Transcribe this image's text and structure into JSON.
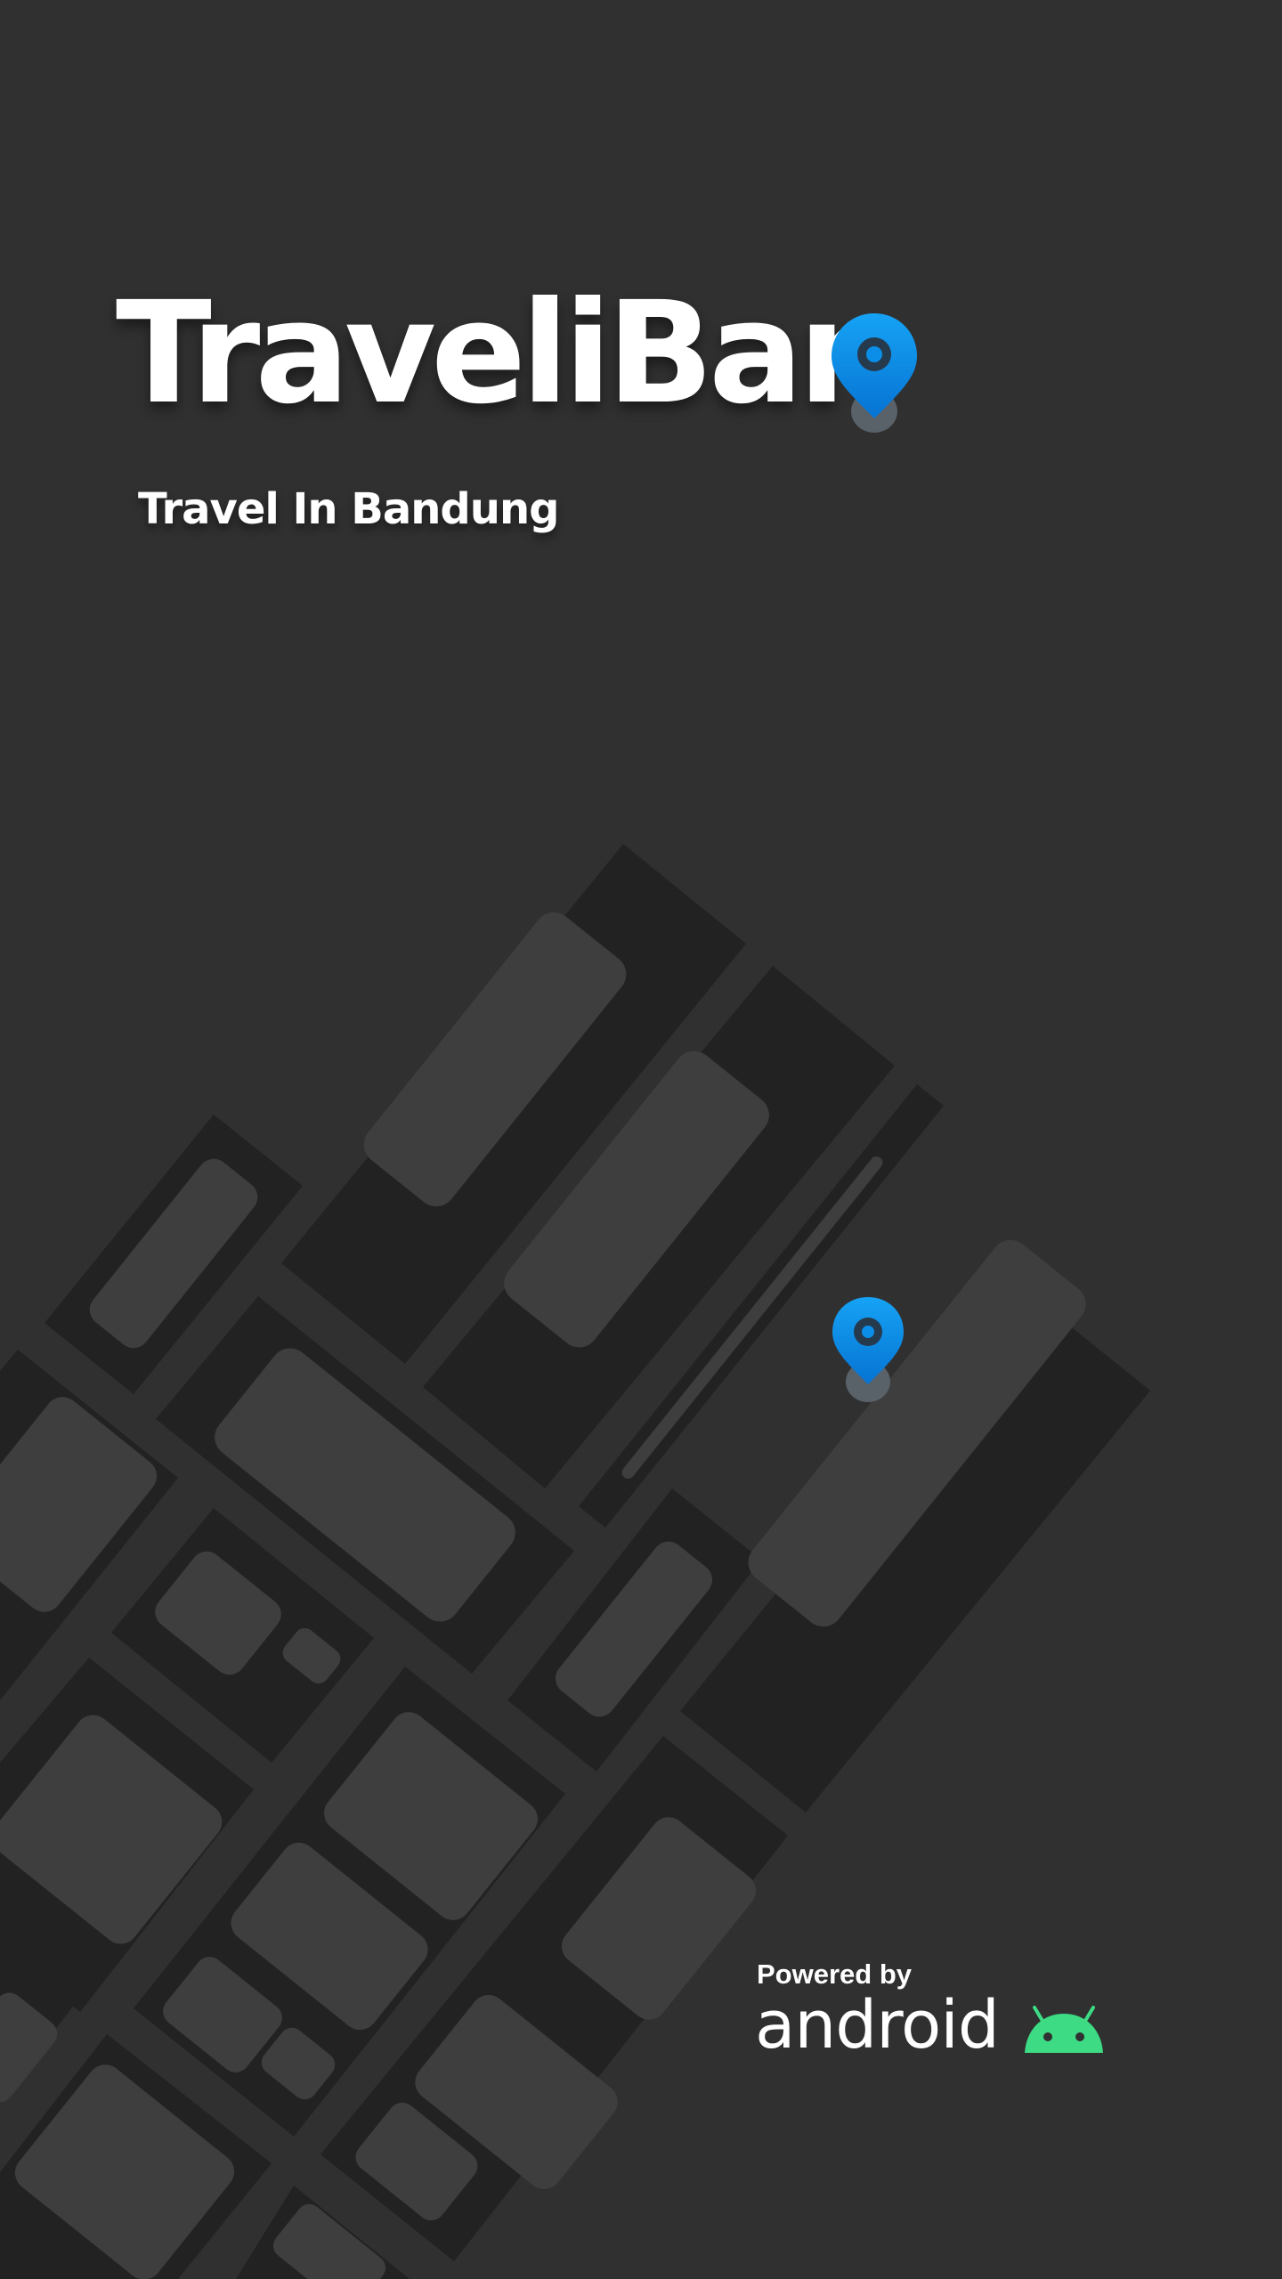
{
  "app": {
    "title": "TraveliBan",
    "subtitle": "Travel In Bandung"
  },
  "footer": {
    "powered_by": "Powered by",
    "platform": "android"
  },
  "icons": {
    "title_pin": "location-pin-icon",
    "map_pin": "location-pin-icon",
    "platform_logo": "android-robot-icon"
  },
  "colors": {
    "background": "#303030",
    "map_road": "#222222",
    "map_block": "#3e3e3e",
    "pin_blue": "#0a8ee8",
    "android_green": "#3ddc84",
    "text": "#ffffff"
  }
}
